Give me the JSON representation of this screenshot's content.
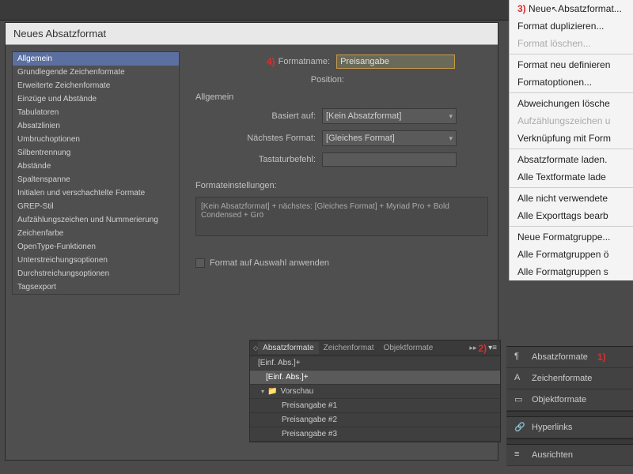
{
  "dialog": {
    "title": "Neues Absatzformat",
    "sidebar": [
      "Allgemein",
      "Grundlegende Zeichenformate",
      "Erweiterte Zeichenformate",
      "Einzüge und Abstände",
      "Tabulatoren",
      "Absatzlinien",
      "Umbruchoptionen",
      "Silbentrennung",
      "Abstände",
      "Spaltenspanne",
      "Initialen und verschachtelte Formate",
      "GREP-Stil",
      "Aufzählungszeichen und Nummerierung",
      "Zeichenfarbe",
      "OpenType-Funktionen",
      "Unterstreichungsoptionen",
      "Durchstreichungsoptionen",
      "Tagsexport"
    ],
    "selected_index": 0,
    "labels": {
      "formatname": "Formatname:",
      "position": "Position:",
      "section": "Allgemein",
      "basiert": "Basiert auf:",
      "naechstes": "Nächstes Format:",
      "tastatur": "Tastaturbefehl:",
      "settings_header": "Formateinstellungen:",
      "apply_cb": "Format auf Auswahl anwenden"
    },
    "values": {
      "formatname": "Preisangabe",
      "basiert": "[Kein Absatzformat]",
      "naechstes": "[Gleiches Format]",
      "tastatur": "",
      "settings_summary": "[Kein Absatzformat] + nächstes: [Gleiches Format] + Myriad Pro + Bold Condensed + Grö"
    },
    "markers": {
      "m4": "4)",
      "m2": "2)"
    }
  },
  "panel": {
    "tabs": [
      "Absatzformate",
      "Zeichenformat",
      "Objektformate"
    ],
    "header_text": "[Einf. Abs.]+",
    "active": "[Einf. Abs.]+",
    "folder": "Vorschau",
    "items": [
      "Preisangabe #1",
      "Preisangabe #2",
      "Preisangabe #3"
    ]
  },
  "context_menu": {
    "marker": "3)",
    "items": [
      {
        "t": "Neues Absatzformat...",
        "d": false,
        "hl": true
      },
      {
        "t": "Format duplizieren...",
        "d": false
      },
      {
        "t": "Format löschen...",
        "d": true
      },
      {
        "sep": true
      },
      {
        "t": "Format neu definieren",
        "d": false
      },
      {
        "t": "Formatoptionen...",
        "d": false
      },
      {
        "sep": true
      },
      {
        "t": "Abweichungen lösche",
        "d": false
      },
      {
        "t": "Aufzählungszeichen u",
        "d": true
      },
      {
        "t": "Verknüpfung mit Form",
        "d": false
      },
      {
        "sep": true
      },
      {
        "t": "Absatzformate laden.",
        "d": false
      },
      {
        "t": "Alle Textformate lade",
        "d": false
      },
      {
        "sep": true
      },
      {
        "t": "Alle nicht verwendete",
        "d": false
      },
      {
        "t": "Alle Exporttags bearb",
        "d": false
      },
      {
        "sep": true
      },
      {
        "t": "Neue Formatgruppe...",
        "d": false
      },
      {
        "t": "Alle Formatgruppen ö",
        "d": false
      },
      {
        "t": "Alle Formatgruppen s",
        "d": false
      }
    ]
  },
  "right_panels": {
    "marker": "1)",
    "items": [
      "Absatzformate",
      "Zeichenformate",
      "Objektformate",
      "Hyperlinks",
      "Ausrichten"
    ]
  }
}
